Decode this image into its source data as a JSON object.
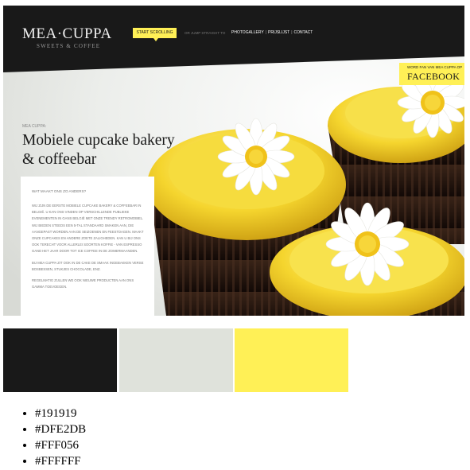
{
  "site": {
    "logo": "MEA·CUPPA",
    "logo_sub": "SWEETS & COFFEE",
    "cta": "START SCROLLING",
    "nav_lead": "OR JUMP STRAIGHT TO",
    "nav": [
      "PHOTOGALLERY",
      "PRIJSLIJST",
      "CONTACT"
    ],
    "facebook_small": "WORD FAN VAN MEA CUPPA OP",
    "facebook_big": "FACEBOOK",
    "tagline": "MEA CUPPA:",
    "headline_line1": "Mobiele cupcake bakery",
    "headline_line2": "& coffeebar",
    "box_heading": "WAT MAAKT ONS ZO ANDERS?",
    "box_paragraphs": [
      "WIJ ZIJN DE EERSTE MOBIELE CUPCAKE BAKERY & COFFEEBAR IN BELGIË. U KAN ONS VINDEN OP VERSCHILLENDE PUBLIEKE EVENEMENTEN IN GANS BELGIË MET ONZE TRENDY RETROMOBIEL. WIJ BIEDEN STEEDS EEN 5-TAL STANDAARD SMAKEN AAN, DIE AANGEPAST WORDEN AAN DE SEIZOENEN EN FEESTDAGEN. MAAKT ONZE CUPCAKES EN ANDERE ZOETE ZALIGHEDEN. KAN U BIJ ONS OOK TERECHT VOOR ALLERLEI SOORTEN KOFFIE - VAN ESPRESSO GAND HET JAAR DOOR TOT ICE COFFEE IN DE ZOMERMAANDEN.",
      "BIJ MEA CUPPA ZIT OOK IN DE CAKE DE SMAAK INGEBAKKEN VERSE BOSBESSEN, STUKJES CHOCOLADE, ENZ.",
      "REGELMATIG ZULLEN WE OOK NIEUWE PRODUCTEN AAN ONS GAMMA TOEVOEGEN."
    ]
  },
  "palette": {
    "colors": [
      "#191919",
      "#DFE2DB",
      "#FFF056",
      "#FFFFFF"
    ],
    "labels": [
      "#191919",
      "#DFE2DB",
      "#FFF056",
      "#FFFFFF"
    ]
  }
}
